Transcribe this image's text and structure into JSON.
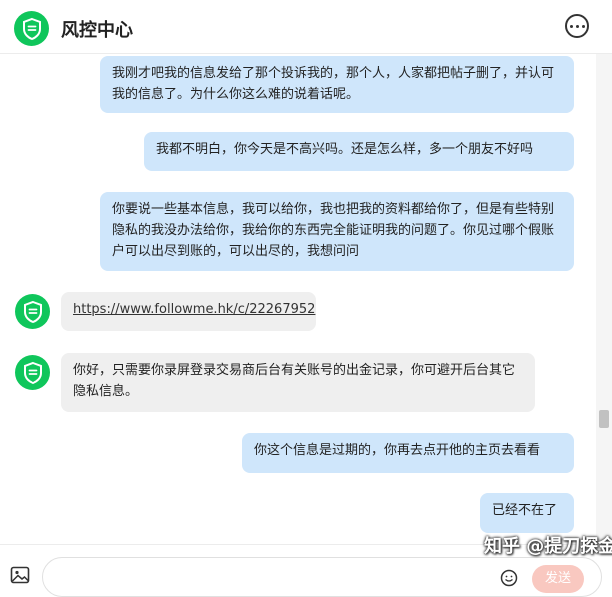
{
  "header": {
    "title": "风控中心",
    "logo_icon": "shield-check-icon",
    "more_icon": "more-horizontal-icon"
  },
  "messages": [
    {
      "side": "out",
      "text": "我刚才吧我的信息发给了那个投诉我的，那个人，人家都把帖子删了，并认可我的信息了。为什么你这么难的说着话呢。"
    },
    {
      "side": "out",
      "text": "我都不明白，你今天是不高兴吗。还是怎么样，多一个朋友不好吗"
    },
    {
      "side": "out",
      "text": "你要说一些基本信息，我可以给你，我也把我的资料都给你了，但是有些特别隐私的我没办法给你，我给你的东西完全能证明我的问题了。你见过哪个假账户可以出尽到账的，可以出尽的，我想问问"
    },
    {
      "side": "in",
      "text": "https://www.followme.hk/c/22267952"
    },
    {
      "side": "in",
      "text": "你好，只需要你录屏登录交易商后台有关账号的出金记录，你可避开后台其它隐私信息。"
    },
    {
      "side": "out",
      "text": "你这个信息是过期的，你再去点开他的主页去看看"
    },
    {
      "side": "out",
      "text": "已经不在了"
    }
  ],
  "input": {
    "send_label": "发送",
    "image_icon": "image-icon",
    "emoji_icon": "emoji-icon"
  },
  "watermark": "知乎 @提刀探金",
  "colors": {
    "brand_green": "#0fc65b",
    "bubble_out": "#cfe6fb",
    "bubble_in": "#efefef"
  }
}
